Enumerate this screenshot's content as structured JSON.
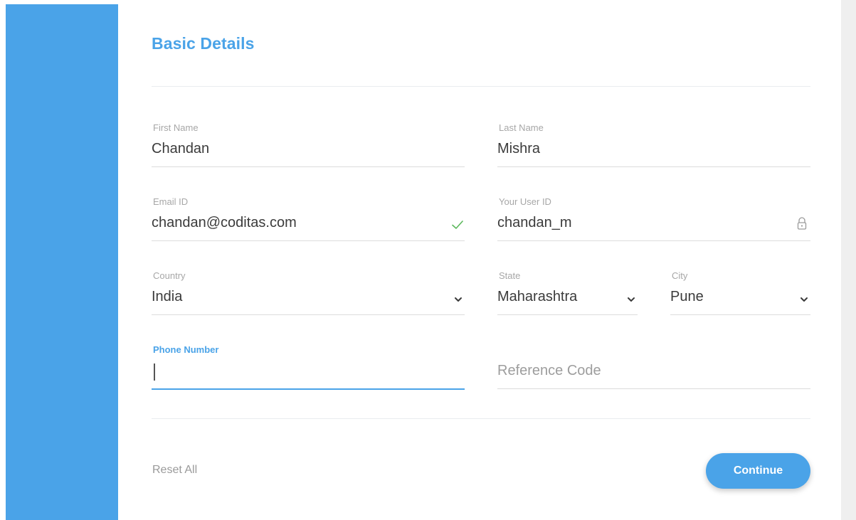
{
  "form": {
    "title": "Basic Details",
    "fields": {
      "first_name": {
        "label": "First Name",
        "value": "Chandan"
      },
      "last_name": {
        "label": "Last Name",
        "value": "Mishra"
      },
      "email": {
        "label": "Email ID",
        "value": "chandan@coditas.com",
        "status_icon": "check-icon"
      },
      "user_id": {
        "label": "Your User ID",
        "value": "chandan_m",
        "status_icon": "lock-icon"
      },
      "country": {
        "label": "Country",
        "value": "India"
      },
      "state": {
        "label": "State",
        "value": "Maharashtra"
      },
      "city": {
        "label": "City",
        "value": "Pune"
      },
      "phone": {
        "label": "Phone Number",
        "value": ""
      },
      "reference": {
        "placeholder": "Reference Code",
        "value": ""
      }
    }
  },
  "actions": {
    "reset_label": "Reset All",
    "continue_label": "Continue"
  },
  "colors": {
    "accent": "#4aa3e8",
    "valid": "#5cb85c",
    "text": "#3b3b3b",
    "label": "#a7a7a7"
  }
}
